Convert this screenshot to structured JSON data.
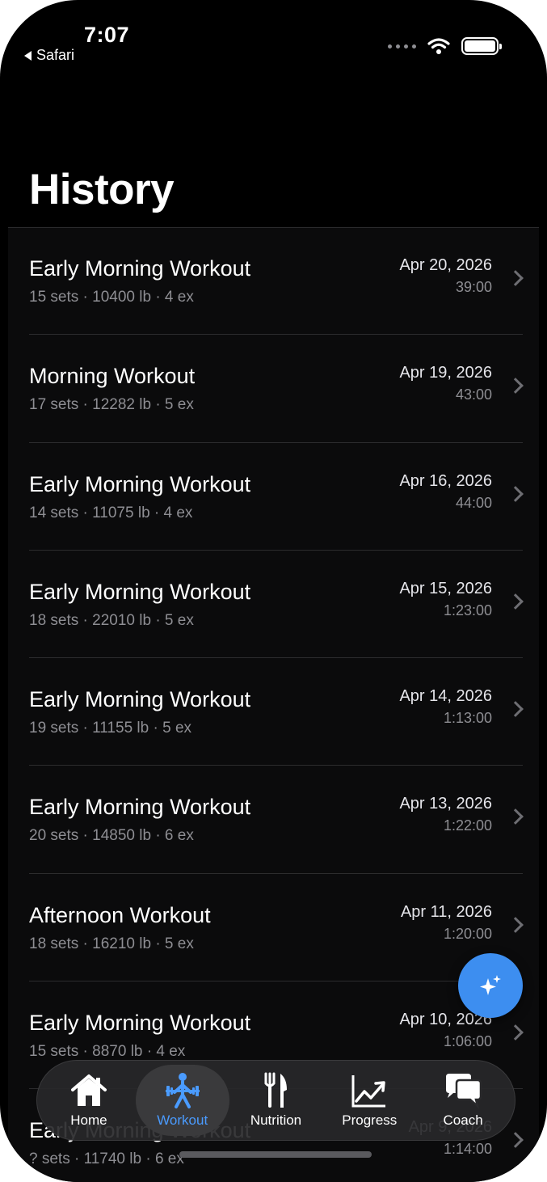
{
  "status_bar": {
    "time": "7:07",
    "back_label": "Safari"
  },
  "page": {
    "title": "History"
  },
  "workouts": [
    {
      "name": "Early Morning Workout",
      "meta": "15 sets · 10400 lb · 4 ex",
      "date": "Apr 20, 2026",
      "duration": "39:00"
    },
    {
      "name": "Morning Workout",
      "meta": "17 sets · 12282 lb · 5 ex",
      "date": "Apr 19, 2026",
      "duration": "43:00"
    },
    {
      "name": "Early Morning Workout",
      "meta": "14 sets · 11075 lb · 4 ex",
      "date": "Apr 16, 2026",
      "duration": "44:00"
    },
    {
      "name": "Early Morning Workout",
      "meta": "18 sets · 22010 lb · 5 ex",
      "date": "Apr 15, 2026",
      "duration": "1:23:00"
    },
    {
      "name": "Early Morning Workout",
      "meta": "19 sets · 11155 lb · 5 ex",
      "date": "Apr 14, 2026",
      "duration": "1:13:00"
    },
    {
      "name": "Early Morning Workout",
      "meta": "20 sets · 14850 lb · 6 ex",
      "date": "Apr 13, 2026",
      "duration": "1:22:00"
    },
    {
      "name": "Afternoon Workout",
      "meta": "18 sets · 16210 lb · 5 ex",
      "date": "Apr 11, 2026",
      "duration": "1:20:00"
    },
    {
      "name": "Early Morning Workout",
      "meta": "15 sets · 8870 lb · 4 ex",
      "date": "Apr 10, 2026",
      "duration": "1:06:00"
    },
    {
      "name": "Early Morning Workout",
      "meta": "? sets · 11740 lb · 6 ex",
      "date": "Apr 9, 2026",
      "duration": "1:14:00"
    }
  ],
  "fab": {
    "icon": "sparkles-icon"
  },
  "tabbar": {
    "accent_color": "#4a9bff",
    "tabs": [
      {
        "label": "Home",
        "icon": "home-icon",
        "active": false
      },
      {
        "label": "Workout",
        "icon": "weightlifter-icon",
        "active": true
      },
      {
        "label": "Nutrition",
        "icon": "fork-knife-icon",
        "active": false
      },
      {
        "label": "Progress",
        "icon": "chart-icon",
        "active": false
      },
      {
        "label": "Coach",
        "icon": "chat-bubbles-icon",
        "active": false
      }
    ]
  }
}
